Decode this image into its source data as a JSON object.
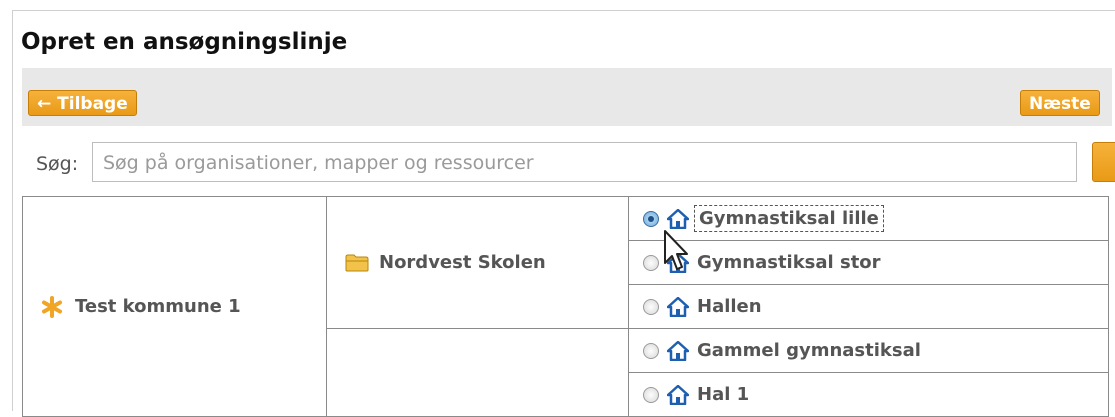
{
  "page": {
    "title": "Opret en ansøgningslinje"
  },
  "toolbar": {
    "back_label": "← Tilbage",
    "next_label": "Næste"
  },
  "search": {
    "label": "Søg:",
    "placeholder": "Søg på organisationer, mapper og ressourcer"
  },
  "tree": {
    "organization": {
      "label": "Test kommune 1",
      "icon": "asterisk-icon"
    },
    "folder": {
      "label": "Nordvest Skolen",
      "icon": "folder-icon"
    },
    "resources": [
      {
        "label": "Gymnastiksal lille",
        "selected": true,
        "icon": "home-icon"
      },
      {
        "label": "Gymnastiksal stor",
        "selected": false,
        "icon": "home-icon"
      },
      {
        "label": "Hallen",
        "selected": false,
        "icon": "home-icon"
      },
      {
        "label": "Gammel gymnastiksal",
        "selected": false,
        "icon": "home-icon"
      },
      {
        "label": "Hal 1",
        "selected": false,
        "icon": "home-icon"
      }
    ]
  },
  "colors": {
    "accent_button": "#f0a527",
    "toolbar_bg": "#e8e8e8",
    "icon_blue": "#1f5fb0",
    "star_orange": "#f0a527"
  }
}
